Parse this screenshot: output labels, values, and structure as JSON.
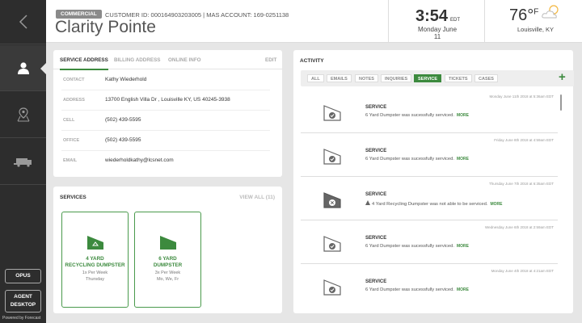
{
  "header": {
    "tag": "COMMERCIAL",
    "customer_line": "CUSTOMER ID: 000164903203005  |  MAS ACCOUNT: 169-0251138",
    "company": "Clarity Pointe",
    "time": "3:54",
    "tz": "EDT",
    "date": "Monday June 11",
    "temp": "76°",
    "unit": "F",
    "location": "Louisville, KY",
    "weather_icon": "partly-cloudy-icon"
  },
  "sidebar": {
    "opus": "OPUS",
    "agent_line1": "AGENT",
    "agent_line2": "DESKTOP",
    "powered": "Powered by Forecast"
  },
  "address_panel": {
    "tabs": [
      "SERVICE ADDRESS",
      "BILLING ADDRESS",
      "ONLINE INFO"
    ],
    "edit": "EDIT",
    "fields": [
      {
        "label": "CONTACT",
        "value": "Kathy Wiederhold"
      },
      {
        "label": "ADDRESS",
        "value": "13700 English Villa Dr , Louisville KY, US 40245-3938"
      },
      {
        "label": "CELL",
        "value": "(502) 439-5595"
      },
      {
        "label": "OFFICE",
        "value": "(502) 439-5595"
      },
      {
        "label": "EMAIL",
        "value": "wiederholdkathy@lcsnet.com"
      }
    ]
  },
  "services": {
    "title": "SERVICES",
    "view_all": "VIEW ALL (11)",
    "cards": [
      {
        "name1": "4 YARD",
        "name2": "RECYCLING DUMPSTER",
        "freq1": "1x Per Week",
        "freq2": "Thursday"
      },
      {
        "name1": "6 YARD",
        "name2": "DUMPSTER",
        "freq1": "3x Per Week",
        "freq2": "Mo, We, Fr"
      }
    ]
  },
  "activity": {
    "title": "ACTIVITY",
    "filters": [
      "ALL",
      "EMAILS",
      "NOTES",
      "INQUIRIES",
      "SERVICE",
      "TICKETS",
      "CASES"
    ],
    "active_filter": "SERVICE",
    "add": "+",
    "items": [
      {
        "time": "Monday June 11th 2018 at 5:36am EDT",
        "title": "SERVICE",
        "desc": "6 Yard Dumpster was sucessfully serviced.",
        "more": "MORE"
      },
      {
        "time": "Friday June 8th 2018 at 4:59am EDT",
        "title": "SERVICE",
        "desc": "6 Yard Dumpster was sucessfully serviced.",
        "more": "MORE"
      },
      {
        "time": "Thursday June 7th 2018 at 6:35am EDT",
        "title": "SERVICE",
        "desc": "4 Yard Recycling Dumpster was not able to be serviced.",
        "more": "MORE"
      },
      {
        "time": "Wednesday June 6th 2018 at 2:59am EDT",
        "title": "SERVICE",
        "desc": "6 Yard Dumpster was sucessfully serviced.",
        "more": "MORE"
      },
      {
        "time": "Monday June 4th 2018 at 4:21am EDT",
        "title": "SERVICE",
        "desc": "6 Yard Dumpster was sucessfully serviced.",
        "more": "MORE"
      }
    ]
  }
}
